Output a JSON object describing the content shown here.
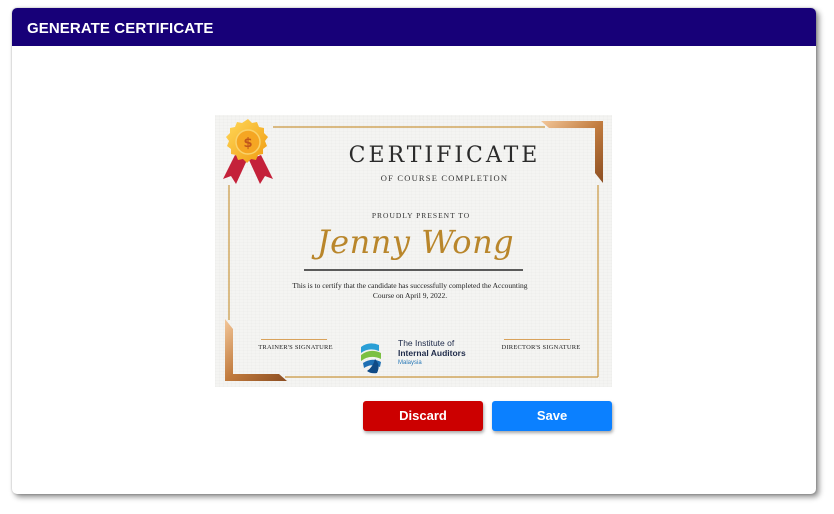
{
  "header": {
    "title": "GENERATE CERTIFICATE"
  },
  "certificate": {
    "title": "CERTIFICATE",
    "subtitle": "OF COURSE COMPLETION",
    "present_text": "PROUDLY PRESENT TO",
    "recipient_name": "Jenny Wong",
    "body_line1": "This is to certify that the candidate has successfully completed the Accounting",
    "body_line2": "Course on April 9, 2022.",
    "trainer_signature_label": "TRAINER'S SIGNATURE",
    "director_signature_label": "DIRECTOR'S SIGNATURE",
    "logo": {
      "line1": "The Institute of",
      "line2": "Internal Auditors",
      "line3": "Malaysia"
    },
    "colors": {
      "gold": "#b9862b",
      "copper": "#c98a4f",
      "badge": "#f6b21a",
      "ribbon": "#c4213a"
    }
  },
  "actions": {
    "discard_label": "Discard",
    "save_label": "Save"
  },
  "colors": {
    "header_bg": "#170078",
    "discard": "#cc0000",
    "save": "#0b80ff"
  }
}
